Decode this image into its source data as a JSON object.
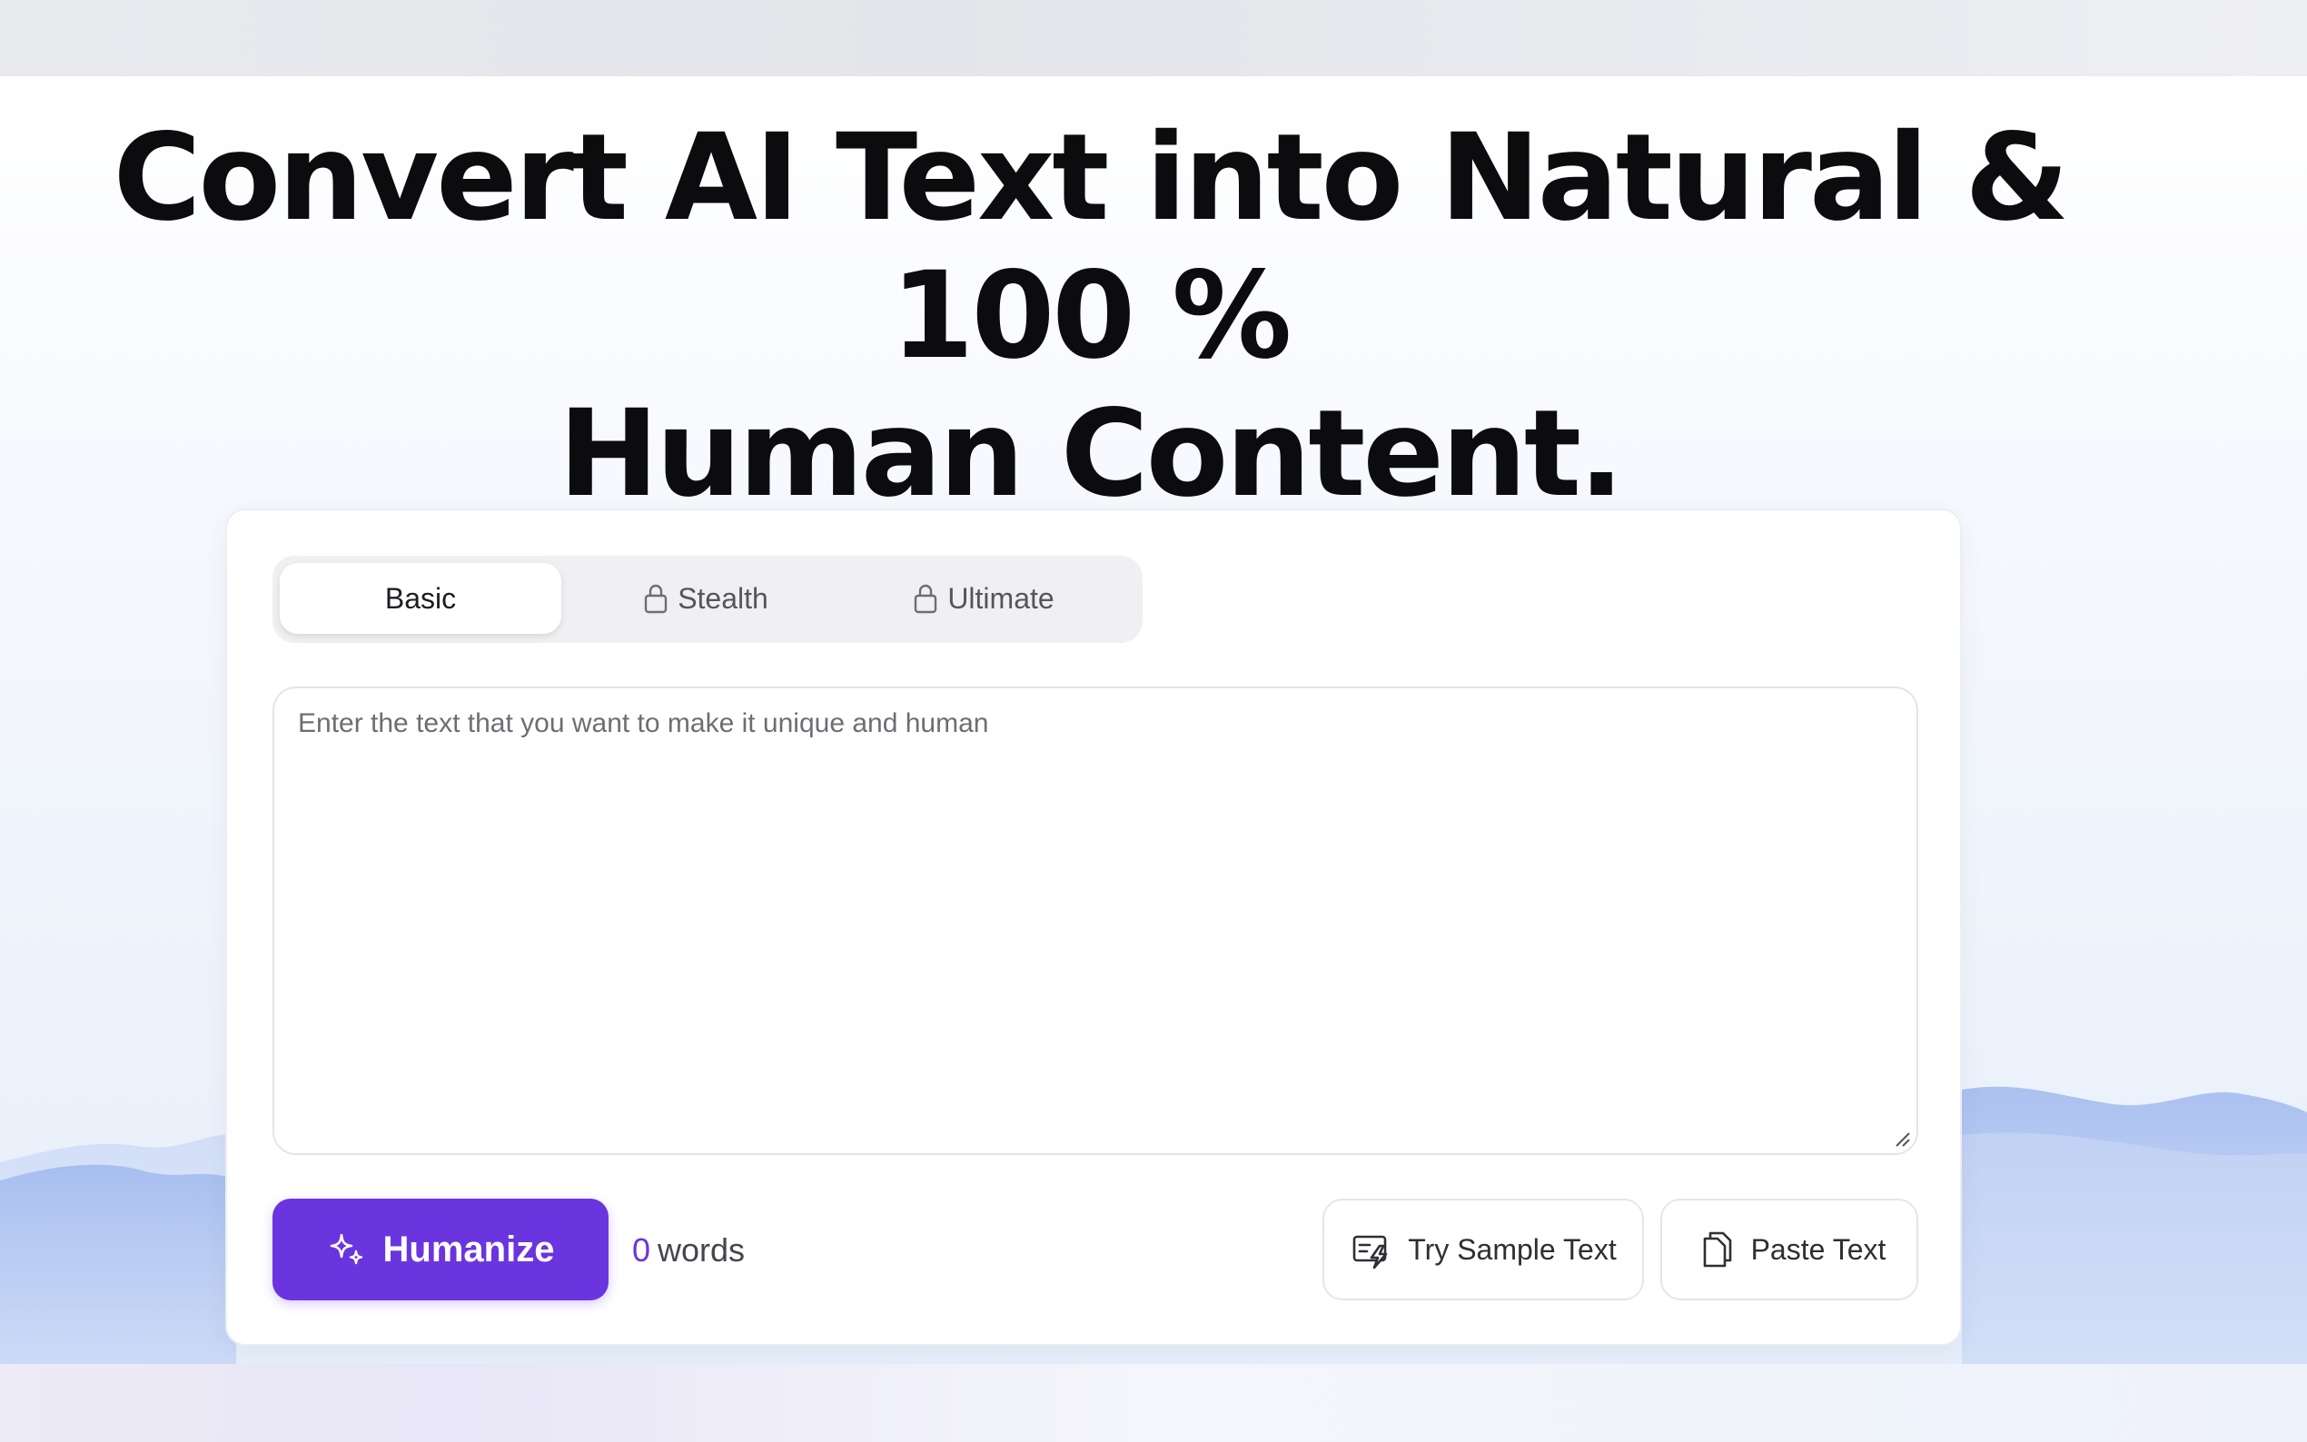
{
  "hero": {
    "headline_line1": "Convert AI Text into Natural & 100 %",
    "headline_line2": "Human Content."
  },
  "tabs": [
    {
      "label": "Basic",
      "active": true,
      "locked": false
    },
    {
      "label": "Stealth",
      "active": false,
      "locked": true
    },
    {
      "label": "Ultimate",
      "active": false,
      "locked": true
    }
  ],
  "editor": {
    "placeholder": "Enter the text that you want to make it unique and human",
    "value": ""
  },
  "actions": {
    "humanize_label": "Humanize",
    "word_count": "0",
    "word_count_unit": "words",
    "sample_label": "Try Sample Text",
    "paste_label": "Paste Text"
  },
  "colors": {
    "accent": "#6a35df",
    "headline": "#0c0c0e",
    "card_bg": "#ffffff",
    "mountain": "#9db7ee"
  },
  "icons": {
    "humanize": "sparkle-icon",
    "tab_lock": "lock-icon",
    "sample": "sample-text-icon",
    "paste": "copy-icon"
  }
}
